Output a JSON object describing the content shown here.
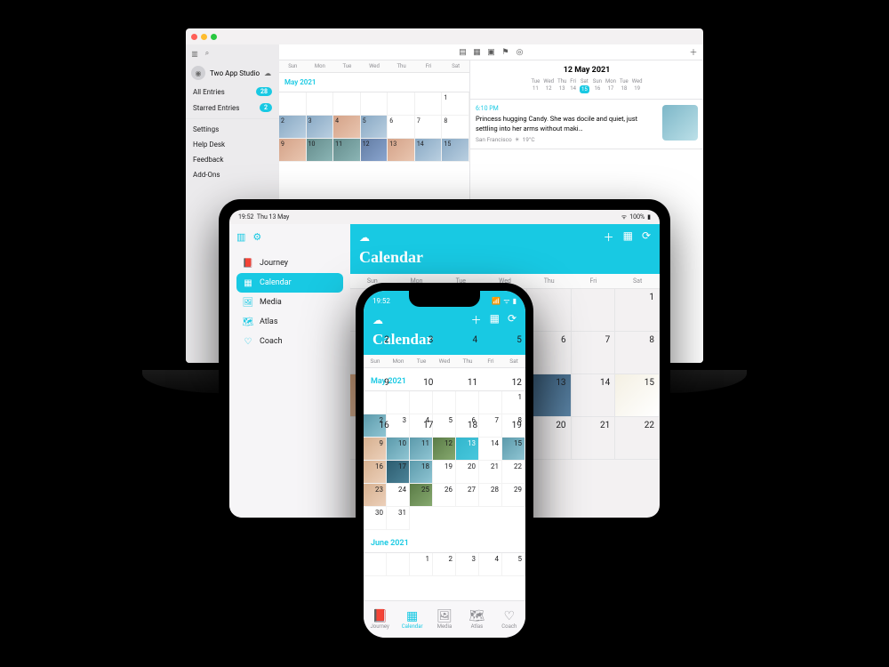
{
  "dow": [
    "Sun",
    "Mon",
    "Tue",
    "Wed",
    "Thu",
    "Fri",
    "Sat"
  ],
  "mac": {
    "account": "Two App Studio",
    "sidebar": [
      {
        "label": "All Entries",
        "badge": "28"
      },
      {
        "label": "Starred Entries",
        "badge": "2"
      }
    ],
    "sidebar2": [
      {
        "label": "Settings"
      },
      {
        "label": "Help Desk"
      },
      {
        "label": "Feedback"
      },
      {
        "label": "Add-Ons"
      }
    ],
    "month_label": "May 2021",
    "detail": {
      "title": "12 May 2021",
      "week": [
        {
          "d": "Tue",
          "n": "11"
        },
        {
          "d": "Wed",
          "n": "12"
        },
        {
          "d": "Thu",
          "n": "13"
        },
        {
          "d": "Fri",
          "n": "14"
        },
        {
          "d": "Sat",
          "n": "15",
          "sel": true
        },
        {
          "d": "Sun",
          "n": "16"
        },
        {
          "d": "Mon",
          "n": "17"
        },
        {
          "d": "Tue",
          "n": "18"
        },
        {
          "d": "Wed",
          "n": "19"
        }
      ],
      "entry_time": "6:10 PM",
      "entry_text": "Princess hugging Candy. She was docile and quiet, just settling into her arms without maki…",
      "entry_loc": "San Francisco",
      "entry_temp": "19°C"
    }
  },
  "ipad": {
    "status_time": "19:52",
    "status_date": "Thu 13 May",
    "status_batt": "100%",
    "sidebar": [
      {
        "label": "Journey",
        "icon": "📕"
      },
      {
        "label": "Calendar",
        "icon": "▦",
        "active": true
      },
      {
        "label": "Media",
        "icon": "🖼"
      },
      {
        "label": "Atlas",
        "icon": "🗺"
      },
      {
        "label": "Coach",
        "icon": "♡"
      }
    ],
    "title": "Calendar"
  },
  "iphone": {
    "status_time": "19:52",
    "title": "Calendar",
    "month1": "May 2021",
    "month2": "June 2021",
    "tabs": [
      {
        "label": "Journey",
        "icon": "📕"
      },
      {
        "label": "Calendar",
        "icon": "▦",
        "active": true
      },
      {
        "label": "Media",
        "icon": "🖼"
      },
      {
        "label": "Atlas",
        "icon": "🗺"
      },
      {
        "label": "Coach",
        "icon": "♡"
      }
    ]
  }
}
